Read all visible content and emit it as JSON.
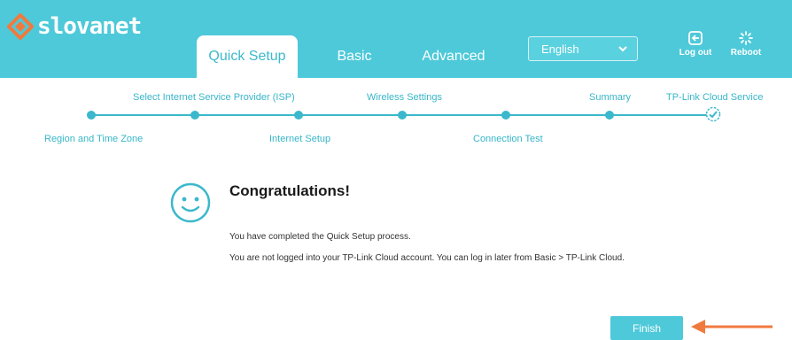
{
  "brand": {
    "name": "slovanet",
    "color": "#4ec9d9",
    "logo_accent": "#f07a3e"
  },
  "nav": {
    "tabs": [
      {
        "label": "Quick Setup",
        "active": true
      },
      {
        "label": "Basic",
        "active": false
      },
      {
        "label": "Advanced",
        "active": false
      }
    ],
    "language": {
      "selected": "English"
    },
    "logout": {
      "label": "Log out",
      "icon": "logout-icon"
    },
    "reboot": {
      "label": "Reboot",
      "icon": "reboot-icon"
    }
  },
  "stepper": {
    "top_labels": [
      "Select Internet Service Provider (ISP)",
      "Wireless Settings",
      "Summary",
      "TP-Link Cloud Service"
    ],
    "bottom_labels": [
      "Region and Time Zone",
      "Internet Setup",
      "Connection Test"
    ],
    "current_step_icon": "check-circle-icon"
  },
  "result": {
    "icon": "smiley-icon",
    "title": "Congratulations!",
    "line1": "You have completed the Quick Setup process.",
    "line2": "You are not logged into your TP-Link Cloud account. You can log in later from Basic > TP-Link Cloud."
  },
  "actions": {
    "finish_label": "Finish",
    "arrow_color": "#f07a3e"
  }
}
